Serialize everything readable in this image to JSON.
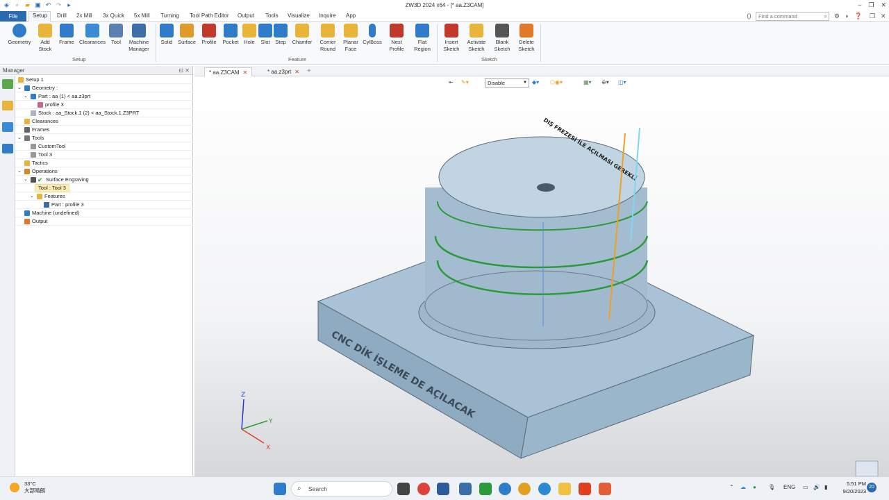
{
  "app": {
    "title": "ZW3D 2024 x64 - [* aa.Z3CAM]"
  },
  "menu": {
    "file": "File",
    "items": [
      "Setup",
      "Drill",
      "2x Mill",
      "3x Quick",
      "5x Mill",
      "Turning",
      "Tool Path Editor",
      "Output",
      "Tools",
      "Visualize",
      "Inquire",
      "App"
    ],
    "find_placeholder": "Find a command"
  },
  "ribbon": {
    "setup": {
      "label": "Setup",
      "buttons": [
        "Geometry",
        "Add Stock",
        "Frame",
        "Clearances",
        "Tool",
        "Machine Manager"
      ]
    },
    "feature": {
      "label": "Feature",
      "buttons": [
        "Solid",
        "Surface",
        "Profile",
        "Pocket",
        "Hole",
        "Slot",
        "Step",
        "Chamfer",
        "Corner Round",
        "Planar Face",
        "CylBoss",
        "Nest Profile",
        "Flat Region"
      ]
    },
    "sketch": {
      "label": "Sketch",
      "buttons": [
        "Insert Sketch",
        "Activate Sketch",
        "Blank Sketch",
        "Delete Sketch"
      ]
    }
  },
  "manager": {
    "title": "Manager",
    "tree": [
      {
        "label": "Setup 1"
      },
      {
        "label": "Geometry :"
      },
      {
        "label": "Part : aa (1) < aa.z3prt"
      },
      {
        "label": "profile 3"
      },
      {
        "label": "Stock : aa_Stock.1 (2) < aa_Stock.1.Z3PRT"
      },
      {
        "label": "Clearances"
      },
      {
        "label": "Frames"
      },
      {
        "label": "Tools"
      },
      {
        "label": "CustomTool"
      },
      {
        "label": "Tool 3"
      },
      {
        "label": "Tactics"
      },
      {
        "label": "Operations"
      },
      {
        "label": "Surface Engraving"
      },
      {
        "label": "Tool : Tool 3"
      },
      {
        "label": "Features"
      },
      {
        "label": "Part : profile 3"
      },
      {
        "label": "Machine (undefined)"
      },
      {
        "label": "Output"
      }
    ]
  },
  "tabs": [
    {
      "label": "* aa.Z3CAM"
    },
    {
      "label": "* aa.z3prt"
    }
  ],
  "viewport": {
    "filter_value": "Disable",
    "top_engraving": "DIŞ FREZESİ İLE AÇILMASI GEREKLİ",
    "side_engraving": "CNC DİK İŞLEME DE AÇILACAK",
    "axis_z": "Z",
    "axis_y": "Y",
    "axis_x": "X"
  },
  "taskbar": {
    "temp": "33°C",
    "weather_text": "大部晴朗",
    "search": "Search",
    "lang": "ENG",
    "time": "5:51 PM",
    "date": "9/20/2023",
    "badge": "20"
  }
}
